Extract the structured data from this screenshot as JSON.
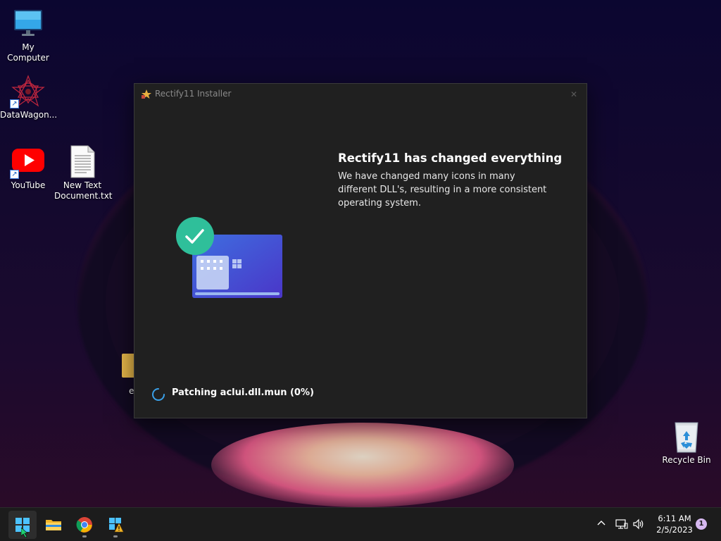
{
  "desktop": {
    "icons": [
      {
        "label": "My Computer",
        "icon": "monitor-icon"
      },
      {
        "label": "DataWagon...",
        "icon": "datawagon-logo-icon"
      },
      {
        "label": "YouTube",
        "icon": "youtube-icon"
      },
      {
        "label": "New Text Document.txt",
        "icon": "text-document-icon"
      },
      {
        "label": "Recycle Bin",
        "icon": "recycle-bin-icon"
      }
    ],
    "partial_icon_label": "e"
  },
  "installer": {
    "title": "Rectify11 Installer",
    "close_icon": "close-icon",
    "heading": "Rectify11 has changed everything",
    "description": "We have changed many icons in many different DLL's, resulting in a more consistent operating system.",
    "status": "Patching aclui.dll.mun (0%)",
    "progress_percent": 0,
    "accent_color": "#3a5bd9",
    "check_color": "#2fbf9a"
  },
  "taskbar": {
    "items": [
      {
        "name": "start",
        "icon": "windows-start-icon"
      },
      {
        "name": "file-explorer",
        "icon": "folder-icon"
      },
      {
        "name": "chrome",
        "icon": "chrome-icon"
      },
      {
        "name": "rectify11-installer",
        "icon": "installer-icon"
      }
    ],
    "tray": {
      "chevron_icon": "chevron-up-icon",
      "network_icon": "network-icon",
      "volume_icon": "volume-icon"
    },
    "clock": {
      "time": "6:11 AM",
      "date": "2/5/2023"
    },
    "notification_count": "1"
  }
}
